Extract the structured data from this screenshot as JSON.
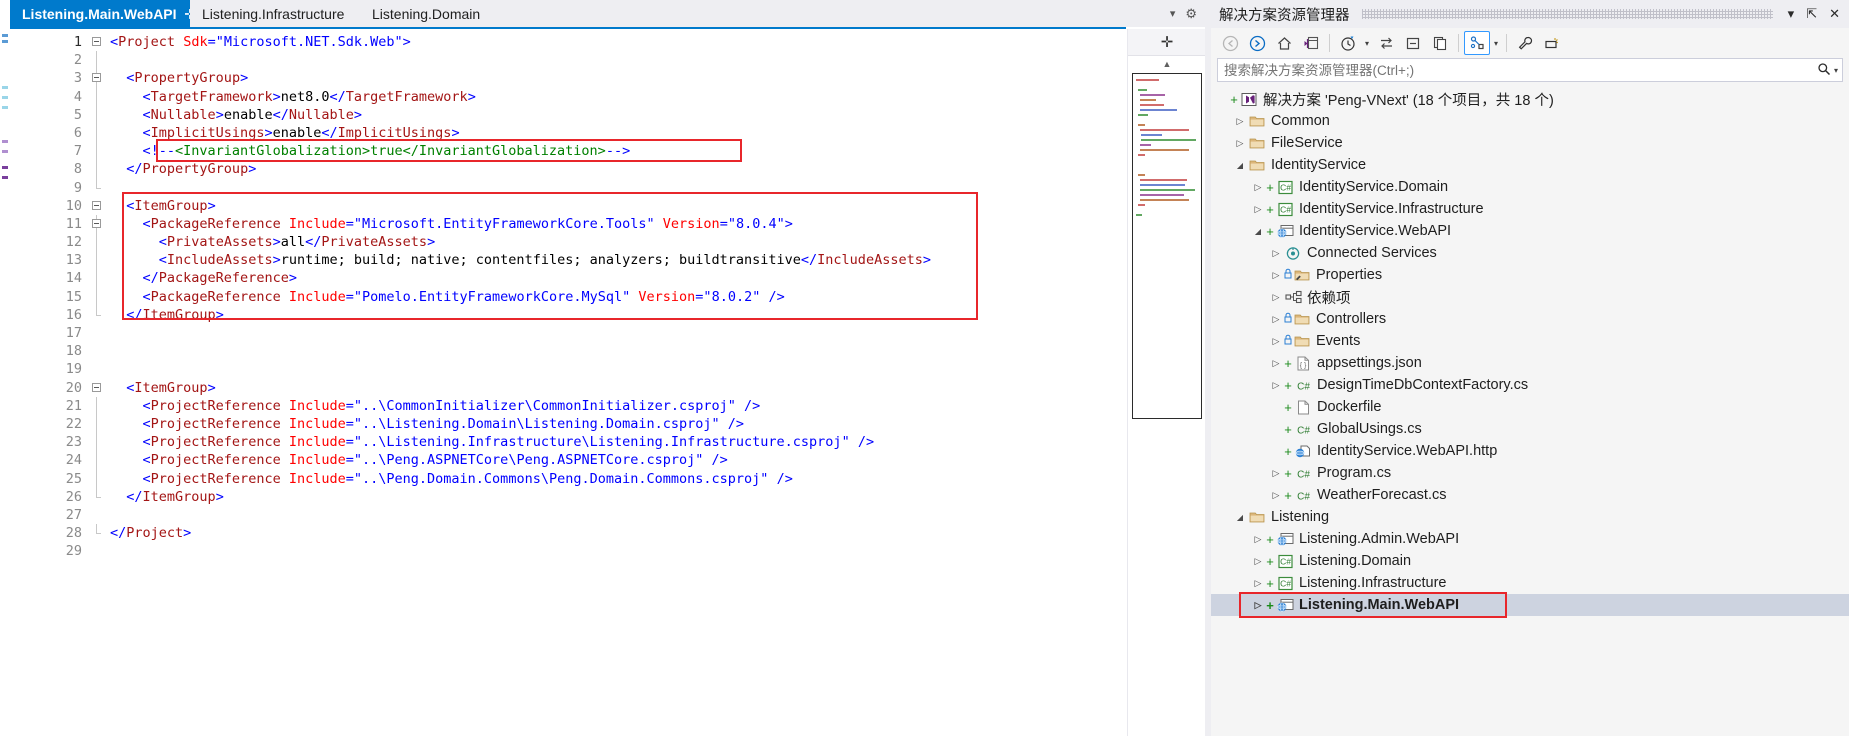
{
  "editor": {
    "tabs": [
      {
        "label": "Listening.Main.WebAPI",
        "active": true,
        "pin": "⊹",
        "close": "✕"
      },
      {
        "label": "Listening.Infrastructure",
        "active": false
      },
      {
        "label": "Listening.Domain",
        "active": false
      }
    ],
    "tabstrip_icons": {
      "dropdown": "▾",
      "settings": "⚙"
    },
    "line_numbers": [
      "1",
      "2",
      "3",
      "4",
      "5",
      "6",
      "7",
      "8",
      "9",
      "10",
      "11",
      "12",
      "13",
      "14",
      "15",
      "16",
      "17",
      "18",
      "19",
      "20",
      "21",
      "22",
      "23",
      "24",
      "25",
      "26",
      "27",
      "28",
      "29"
    ],
    "lines": [
      {
        "n": 1,
        "text": "<Project Sdk=\"Microsoft.NET.Sdk.Web\">"
      },
      {
        "n": 2,
        "text": ""
      },
      {
        "n": 3,
        "text": "  <PropertyGroup>"
      },
      {
        "n": 4,
        "text": "    <TargetFramework>net8.0</TargetFramework>"
      },
      {
        "n": 5,
        "text": "    <Nullable>enable</Nullable>"
      },
      {
        "n": 6,
        "text": "    <ImplicitUsings>enable</ImplicitUsings>"
      },
      {
        "n": 7,
        "text": "    <!--<InvariantGlobalization>true</InvariantGlobalization>-->"
      },
      {
        "n": 8,
        "text": "  </PropertyGroup>"
      },
      {
        "n": 9,
        "text": ""
      },
      {
        "n": 10,
        "text": "  <ItemGroup>"
      },
      {
        "n": 11,
        "text": "    <PackageReference Include=\"Microsoft.EntityFrameworkCore.Tools\" Version=\"8.0.4\">"
      },
      {
        "n": 12,
        "text": "      <PrivateAssets>all</PrivateAssets>"
      },
      {
        "n": 13,
        "text": "      <IncludeAssets>runtime; build; native; contentfiles; analyzers; buildtransitive</IncludeAssets>"
      },
      {
        "n": 14,
        "text": "    </PackageReference>"
      },
      {
        "n": 15,
        "text": "    <PackageReference Include=\"Pomelo.EntityFrameworkCore.MySql\" Version=\"8.0.2\" />"
      },
      {
        "n": 16,
        "text": "  </ItemGroup>"
      },
      {
        "n": 17,
        "text": ""
      },
      {
        "n": 18,
        "text": ""
      },
      {
        "n": 19,
        "text": ""
      },
      {
        "n": 20,
        "text": "  <ItemGroup>"
      },
      {
        "n": 21,
        "text": "    <ProjectReference Include=\"..\\CommonInitializer\\CommonInitializer.csproj\" />"
      },
      {
        "n": 22,
        "text": "    <ProjectReference Include=\"..\\Listening.Domain\\Listening.Domain.csproj\" />"
      },
      {
        "n": 23,
        "text": "    <ProjectReference Include=\"..\\Listening.Infrastructure\\Listening.Infrastructure.csproj\" />"
      },
      {
        "n": 24,
        "text": "    <ProjectReference Include=\"..\\Peng.ASPNETCore\\Peng.ASPNETCore.csproj\" />"
      },
      {
        "n": 25,
        "text": "    <ProjectReference Include=\"..\\Peng.Domain.Commons\\Peng.Domain.Commons.csproj\" />"
      },
      {
        "n": 26,
        "text": "  </ItemGroup>"
      },
      {
        "n": 27,
        "text": ""
      },
      {
        "n": 28,
        "text": "</Project>"
      },
      {
        "n": 29,
        "text": ""
      }
    ],
    "minimap": {
      "split_icon": "✛",
      "scroll_up": "▲"
    }
  },
  "colors": {
    "accent": "#007acc",
    "annotation": "#e8262b",
    "tag": "#a31515",
    "attribute": "#ff0000",
    "value": "#0000ff",
    "comment": "#008000",
    "selection": "#cdd3e0"
  },
  "solution_explorer": {
    "title": "解决方案资源管理器",
    "title_buttons": {
      "dropdown": "▾",
      "pin": "⇱",
      "close": "✕"
    },
    "toolbar": [
      {
        "name": "back",
        "glyph": "←"
      },
      {
        "name": "forward",
        "glyph": "→"
      },
      {
        "name": "home",
        "glyph": "⌂"
      },
      {
        "name": "switch-views",
        "glyph": "▣"
      },
      {
        "name": "pending-changes",
        "glyph": "◔"
      },
      {
        "name": "sync-with-active-document",
        "glyph": "⇆"
      },
      {
        "name": "collapse-all",
        "glyph": "▤"
      },
      {
        "name": "show-all-files",
        "glyph": "❐"
      },
      {
        "name": "properties-view",
        "glyph": "⚙"
      },
      {
        "name": "properties-window",
        "glyph": "🔧"
      },
      {
        "name": "preview-selected-items",
        "glyph": "⚏"
      }
    ],
    "search": {
      "placeholder": "搜索解决方案资源管理器(Ctrl+;)",
      "value": "",
      "icon": "search-icon"
    },
    "tree": [
      {
        "depth": 0,
        "twisty": "+",
        "label": "解决方案 'Peng-VNext' (18 个项目，共 18 个)",
        "icon": "solution",
        "plus": true
      },
      {
        "depth": 1,
        "twisty": "▷",
        "label": "Common",
        "icon": "folder"
      },
      {
        "depth": 1,
        "twisty": "▷",
        "label": "FileService",
        "icon": "folder"
      },
      {
        "depth": 1,
        "twisty": "◢",
        "label": "IdentityService",
        "icon": "folder"
      },
      {
        "depth": 2,
        "twisty": "▷",
        "label": "IdentityService.Domain",
        "icon": "csproj",
        "plus": true
      },
      {
        "depth": 2,
        "twisty": "▷",
        "label": "IdentityService.Infrastructure",
        "icon": "csproj",
        "plus": true
      },
      {
        "depth": 2,
        "twisty": "◢",
        "label": "IdentityService.WebAPI",
        "icon": "webapi",
        "plus": true
      },
      {
        "depth": 3,
        "twisty": "▷",
        "label": "Connected Services",
        "icon": "connected"
      },
      {
        "depth": 3,
        "twisty": "▷",
        "label": "Properties",
        "icon": "props-folder",
        "lock": true
      },
      {
        "depth": 3,
        "twisty": "▷",
        "label": "依赖项",
        "icon": "dependencies"
      },
      {
        "depth": 3,
        "twisty": "▷",
        "label": "Controllers",
        "icon": "folder",
        "lock": true
      },
      {
        "depth": 3,
        "twisty": "▷",
        "label": "Events",
        "icon": "folder",
        "lock": true
      },
      {
        "depth": 3,
        "twisty": "▷",
        "label": "appsettings.json",
        "icon": "json",
        "plus": true
      },
      {
        "depth": 3,
        "twisty": "▷",
        "label": "DesignTimeDbContextFactory.cs",
        "icon": "cs",
        "plus": true
      },
      {
        "depth": 3,
        "twisty": "",
        "label": "Dockerfile",
        "icon": "file",
        "plus": true
      },
      {
        "depth": 3,
        "twisty": "",
        "label": "GlobalUsings.cs",
        "icon": "cs",
        "plus": true
      },
      {
        "depth": 3,
        "twisty": "",
        "label": "IdentityService.WebAPI.http",
        "icon": "http",
        "plus": true
      },
      {
        "depth": 3,
        "twisty": "▷",
        "label": "Program.cs",
        "icon": "cs",
        "plus": true
      },
      {
        "depth": 3,
        "twisty": "▷",
        "label": "WeatherForecast.cs",
        "icon": "cs",
        "plus": true
      },
      {
        "depth": 1,
        "twisty": "◢",
        "label": "Listening",
        "icon": "folder"
      },
      {
        "depth": 2,
        "twisty": "▷",
        "label": "Listening.Admin.WebAPI",
        "icon": "webapi",
        "plus": true
      },
      {
        "depth": 2,
        "twisty": "▷",
        "label": "Listening.Domain",
        "icon": "csproj",
        "plus": true
      },
      {
        "depth": 2,
        "twisty": "▷",
        "label": "Listening.Infrastructure",
        "icon": "csproj",
        "plus": true
      },
      {
        "depth": 2,
        "twisty": "▷",
        "label": "Listening.Main.WebAPI",
        "icon": "webapi",
        "plus": true,
        "selected": true,
        "annotated": true
      }
    ]
  }
}
